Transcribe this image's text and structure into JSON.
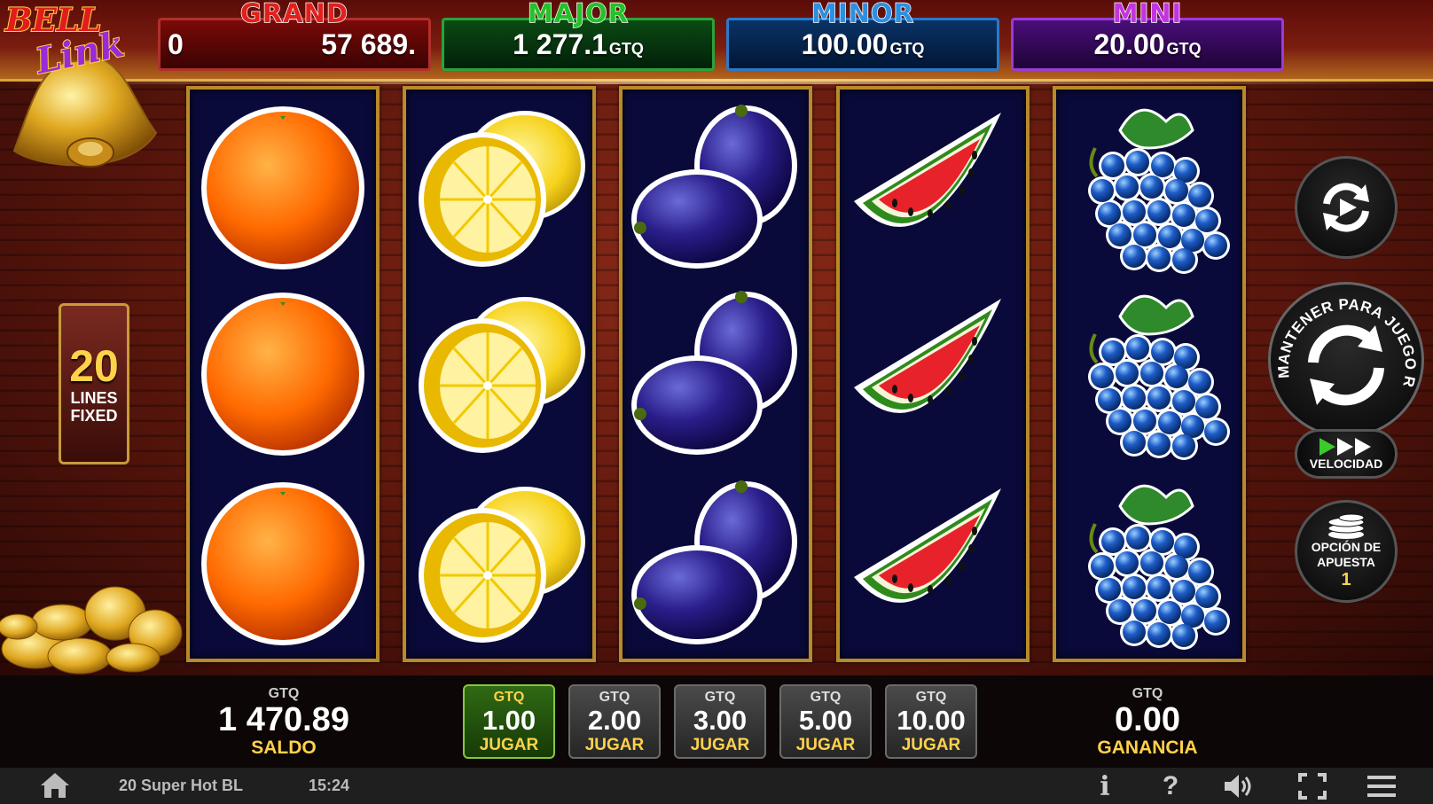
{
  "jackpots": {
    "grand": {
      "title": "GRAND",
      "left_fragment": "0",
      "value": "57 689.",
      "currency": ""
    },
    "major": {
      "title": "MAJOR",
      "value": "1 277.1",
      "currency": "GTQ"
    },
    "minor": {
      "title": "MINOR",
      "value": "100.00",
      "currency": "GTQ"
    },
    "mini": {
      "title": "MINI",
      "value": "20.00",
      "currency": "GTQ"
    }
  },
  "logo": {
    "line1": "BELL",
    "line2": "Link"
  },
  "lines": {
    "count": "20",
    "label1": "LINES",
    "label2": "FIXED"
  },
  "reels": [
    [
      "orange",
      "orange",
      "orange"
    ],
    [
      "lemon",
      "lemon",
      "lemon"
    ],
    [
      "plum",
      "plum",
      "plum"
    ],
    [
      "watermelon",
      "watermelon",
      "watermelon"
    ],
    [
      "grapes",
      "grapes",
      "grapes"
    ]
  ],
  "controls": {
    "autoplay_icon": "autoplay-icon",
    "spin_ring_text": "MANTENER PARA JUEGO RÁPIDO",
    "speed_label": "VELOCIDAD",
    "bet_option_label1": "OPCIÓN DE",
    "bet_option_label2": "APUESTA",
    "bet_option_value": "1"
  },
  "balance": {
    "currency": "GTQ",
    "value": "1 470.89",
    "label": "SALDO"
  },
  "win": {
    "currency": "GTQ",
    "value": "0.00",
    "label": "GANANCIA"
  },
  "bets": [
    {
      "currency": "GTQ",
      "value": "1.00",
      "label": "JUGAR",
      "active": true
    },
    {
      "currency": "GTQ",
      "value": "2.00",
      "label": "JUGAR",
      "active": false
    },
    {
      "currency": "GTQ",
      "value": "3.00",
      "label": "JUGAR",
      "active": false
    },
    {
      "currency": "GTQ",
      "value": "5.00",
      "label": "JUGAR",
      "active": false
    },
    {
      "currency": "GTQ",
      "value": "10.00",
      "label": "JUGAR",
      "active": false
    }
  ],
  "footer": {
    "game_name": "20 Super Hot BL",
    "time": "15:24",
    "info": "i",
    "help": "?"
  },
  "colors": {
    "gold": "#ffd24a",
    "grand": "#e0201c",
    "major": "#25c02a",
    "minor": "#2d8fe0",
    "mini": "#c234e0"
  }
}
